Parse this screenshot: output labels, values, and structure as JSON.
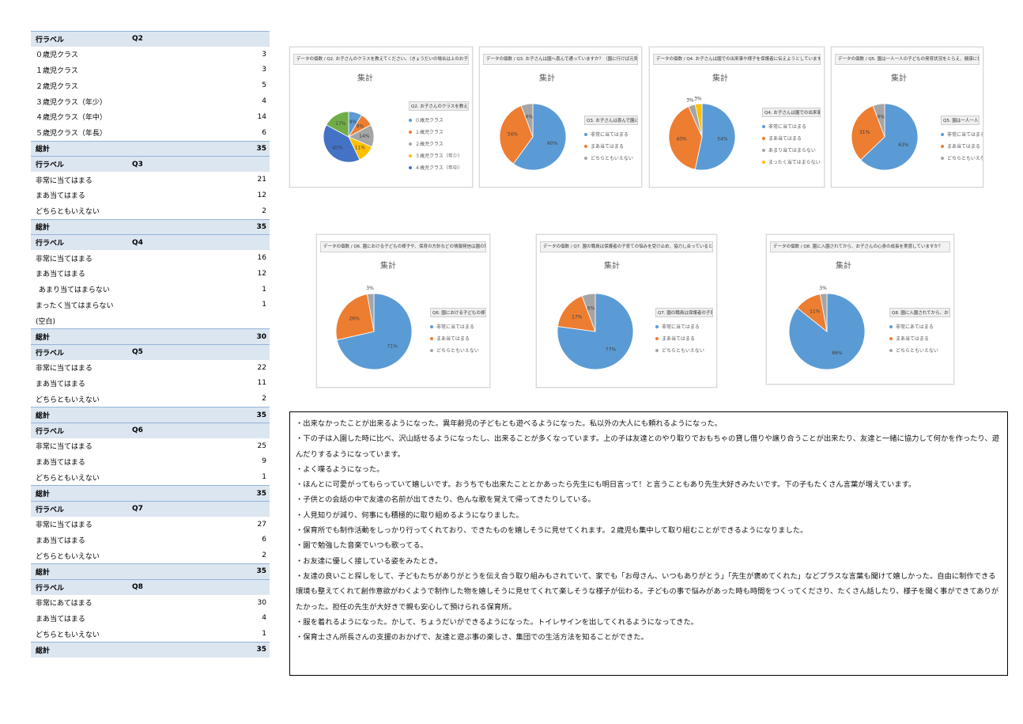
{
  "pivot": {
    "sections": [
      {
        "header": {
          "label": "行ラベル",
          "q": "Q2"
        },
        "rows": [
          {
            "label": "０歳児クラス",
            "value": "3"
          },
          {
            "label": "１歳児クラス",
            "value": "3"
          },
          {
            "label": "２歳児クラス",
            "value": "5"
          },
          {
            "label": "３歳児クラス（年少）",
            "value": "4"
          },
          {
            "label": "４歳児クラス（年中）",
            "value": "14"
          },
          {
            "label": "５歳児クラス（年長）",
            "value": "6"
          }
        ],
        "total": {
          "label": "総計",
          "value": "35"
        }
      },
      {
        "header": {
          "label": "行ラベル",
          "q": "Q3"
        },
        "rows": [
          {
            "label": "非常に当てはまる",
            "value": "21"
          },
          {
            "label": "まあ当てはまる",
            "value": "12"
          },
          {
            "label": "どちらともいえない",
            "value": "2"
          }
        ],
        "total": {
          "label": "総計",
          "value": "35"
        }
      },
      {
        "header": {
          "label": "行ラベル",
          "q": "Q4"
        },
        "rows": [
          {
            "label": "非常に当てはまる",
            "value": "16"
          },
          {
            "label": "まあ当てはまる",
            "value": "12"
          },
          {
            "label": "あまり当てはまらない",
            "value": "1"
          },
          {
            "label": "まったく当てはまらない",
            "value": "1"
          },
          {
            "label": "(空白)",
            "value": ""
          }
        ],
        "total": {
          "label": "総計",
          "value": "30"
        }
      },
      {
        "header": {
          "label": "行ラベル",
          "q": "Q5"
        },
        "rows": [
          {
            "label": "非常に当てはまる",
            "value": "22"
          },
          {
            "label": "まあ当てはまる",
            "value": "11"
          },
          {
            "label": "どちらともいえない",
            "value": "2"
          }
        ],
        "total": {
          "label": "総計",
          "value": "35"
        }
      },
      {
        "header": {
          "label": "行ラベル",
          "q": "Q6"
        },
        "rows": [
          {
            "label": "非常に当てはまる",
            "value": "25"
          },
          {
            "label": "まあ当てはまる",
            "value": "9"
          },
          {
            "label": "どちらともいえない",
            "value": "1"
          }
        ],
        "total": {
          "label": "総計",
          "value": "35"
        }
      },
      {
        "header": {
          "label": "行ラベル",
          "q": "Q7"
        },
        "rows": [
          {
            "label": "非常に当てはまる",
            "value": "27"
          },
          {
            "label": "まあ当てはまる",
            "value": "6"
          },
          {
            "label": "どちらともいえない",
            "value": "2"
          }
        ],
        "total": {
          "label": "総計",
          "value": "35"
        }
      },
      {
        "header": {
          "label": "行ラベル",
          "q": "Q8"
        },
        "rows": [
          {
            "label": "非常にあてはまる",
            "value": "30"
          },
          {
            "label": "まあ当てはまる",
            "value": "4"
          },
          {
            "label": "どちらともいえない",
            "value": "1"
          }
        ],
        "total": {
          "label": "総計",
          "value": "35"
        }
      }
    ]
  },
  "colors": {
    "blue": "#5b9bd5",
    "orange": "#ed7d31",
    "gray": "#a5a5a5",
    "yellow": "#ffc000",
    "navy": "#4472c4",
    "green": "#70ad47",
    "header_fill": "#dce6f1"
  },
  "chart_data": [
    {
      "type": "pie",
      "title": "データの個数 / Q2. お子さんのクラスを教えてください。（きょうだいの場合は上のお子さんの年齢をお答えくだ...",
      "subtitle": "集計",
      "legend_title": "Q2. お子さんのクラスを教えてくい... ▾",
      "labels": [
        "０歳児クラス",
        "１歳児クラス",
        "２歳児クラス",
        "３歳児クラス（年少）",
        "４歳児クラス（年中）"
      ],
      "slices": [
        {
          "label": "０歳児クラス",
          "value": 3,
          "pct": "9%",
          "color": "#5b9bd5"
        },
        {
          "label": "１歳児クラス",
          "value": 3,
          "pct": "9%",
          "color": "#ed7d31"
        },
        {
          "label": "２歳児クラス",
          "value": 5,
          "pct": "14%",
          "color": "#a5a5a5"
        },
        {
          "label": "３歳児クラス（年少）",
          "value": 4,
          "pct": "11%",
          "color": "#ffc000"
        },
        {
          "label": "４歳児クラス（年中）",
          "value": 14,
          "pct": "40%",
          "color": "#4472c4"
        },
        {
          "label": "５歳児クラス（年長）",
          "value": 6,
          "pct": "17%",
          "color": "#70ad47"
        }
      ]
    },
    {
      "type": "pie",
      "title": "データの個数 / Q3. お子さんは園へ喜んで通っていますか？（園に行けば元気に過ごしていますか？）[回答...",
      "subtitle": "集計",
      "legend_title": "Q3. お子さんは喜んで園に... ▾",
      "labels": [
        "非常に当てはまる",
        "まあ当てはまる",
        "どちらともいえない"
      ],
      "slices": [
        {
          "label": "非常に当てはまる",
          "value": 21,
          "pct": "60%",
          "color": "#5b9bd5"
        },
        {
          "label": "まあ当てはまる",
          "value": 12,
          "pct": "34%",
          "color": "#ed7d31"
        },
        {
          "label": "どちらともいえない",
          "value": 2,
          "pct": "6%",
          "color": "#a5a5a5"
        }
      ]
    },
    {
      "type": "pie",
      "title": "データの個数 / Q4. お子さんは園での出来事や様子を保護者に伝えようとしていますか？（言葉でコミュニケーションができる年...",
      "subtitle": "集計",
      "legend_title": "Q4. お子さんは園での出来事や様... ▾",
      "labels": [
        "非常に当てはまる",
        "まあ当てはまる",
        "あまり当てはまらない",
        "まったく当てはまらない"
      ],
      "slices": [
        {
          "label": "非常に当てはまる",
          "value": 16,
          "pct": "54%",
          "color": "#5b9bd5"
        },
        {
          "label": "まあ当てはまる",
          "value": 12,
          "pct": "40%",
          "color": "#ed7d31"
        },
        {
          "label": "あまり当てはまらない",
          "value": 1,
          "pct": "3%",
          "color": "#a5a5a5"
        },
        {
          "label": "まったく当てはまらない",
          "value": 1,
          "pct": "3%",
          "color": "#ffc000"
        }
      ]
    },
    {
      "type": "pie",
      "title": "データの個数 / Q5. 園は一人一人の子どもの発育状況をとらえ、健康に保護者が子育てに支援を行っていますか？[回答必須]",
      "subtitle": "集計",
      "legend_title": "Q5. 園は一人一人の子どもの発育... ▾",
      "labels": [
        "非常に当てはまる",
        "まあ当てはまる",
        "どちらともいえない"
      ],
      "slices": [
        {
          "label": "非常に当てはまる",
          "value": 22,
          "pct": "63%",
          "color": "#5b9bd5"
        },
        {
          "label": "まあ当てはまる",
          "value": 11,
          "pct": "31%",
          "color": "#ed7d31"
        },
        {
          "label": "どちらともいえない",
          "value": 2,
          "pct": "6%",
          "color": "#a5a5a5"
        }
      ]
    },
    {
      "type": "pie",
      "title": "データの個数 / Q6. 園における子どもの様子や、保育の方針などの情報発信は園の取り組みが伝わるものですか？[回答必須]",
      "subtitle": "集計",
      "legend_title": "Q6. 園における子どもの様子や、保育... ▾",
      "labels": [
        "非常に当てはまる",
        "まあ当てはまる",
        "どちらともいえない"
      ],
      "slices": [
        {
          "label": "非常に当てはまる",
          "value": 25,
          "pct": "71%",
          "color": "#5b9bd5"
        },
        {
          "label": "まあ当てはまる",
          "value": 9,
          "pct": "26%",
          "color": "#ed7d31"
        },
        {
          "label": "どちらともいえない",
          "value": 1,
          "pct": "3%",
          "color": "#a5a5a5"
        }
      ]
    },
    {
      "type": "pie",
      "title": "データの個数 / Q7. 園の職員は保護者の子育ての悩みを受け止め、協力し合っていると感じられますか？[回答必須]",
      "subtitle": "集計",
      "legend_title": "Q7. 園の職員は保護者の子育て... ▾",
      "labels": [
        "非常に当てはまる",
        "まあ当てはまる",
        "どちらともいえない"
      ],
      "slices": [
        {
          "label": "非常に当てはまる",
          "value": 27,
          "pct": "77%",
          "color": "#5b9bd5"
        },
        {
          "label": "まあ当てはまる",
          "value": 6,
          "pct": "17%",
          "color": "#ed7d31"
        },
        {
          "label": "どちらともいえない",
          "value": 2,
          "pct": "6%",
          "color": "#a5a5a5"
        }
      ]
    },
    {
      "type": "pie",
      "title": "データの個数 / Q8. 園に入園されてから、お子さんの心身の成長を実感していますか？",
      "subtitle": "集計",
      "legend_title": "Q8. 園に入園されてから、お子さん... ▾",
      "labels": [
        "非常にあてはまる",
        "まあ当てはまる",
        "どちらともいえない"
      ],
      "slices": [
        {
          "label": "非常にあてはまる",
          "value": 30,
          "pct": "86%",
          "color": "#5b9bd5"
        },
        {
          "label": "まあ当てはまる",
          "value": 4,
          "pct": "11%",
          "color": "#ed7d31"
        },
        {
          "label": "どちらともいえない",
          "value": 1,
          "pct": "3%",
          "color": "#a5a5a5"
        }
      ]
    }
  ],
  "comments": [
    "・出来なかったことが出来るようになった。異年齢児の子どもとも遊べるようになった。私以外の大人にも頼れるようになった。",
    "・下の子は入園した時に比べ、沢山話せるようになったし、出来ることが多くなっています。上の子は友達とのやり取りでおもちゃの貸し借りや譲り合うことが出来たり、友達と一緒に協力して何かを作ったり、遊んだりするようになっています。",
    "・よく喋るようになった。",
    "・ほんとに可愛がってもらっていて嬉しいです。おうちでも出来たこととかあったら先生にも明日言って！と言うこともあり先生大好きみたいです。下の子もたくさん言葉が増えています。",
    "・子供との会話の中で友達の名前が出てきたり、色んな歌を覚えて帰ってきたりしている。",
    "・人見知りが減り、何事にも積極的に取り組めるようになりました。",
    "・保育所でも制作活動をしっかり行ってくれており、できたものを嬉しそうに見せてくれます。２歳児も集中して取り組むことができるようになりました。",
    "・園で勉強した音楽でいつも歌ってる。",
    "・お友達に優しく接している姿をみたとき。",
    "・友達の良いこと探しをして、子どもたちがありがとうを伝え合う取り組みもされていて、家でも「お母さん、いつもありがとう」「先生が褒めてくれた」などプラスな言葉も聞けて嬉しかった。自由に制作できる環境も整えてくれて創作意欲がわくようで制作した物を嬉しそうに見せてくれて楽しそうな様子が伝わる。子どもの事で悩みがあった時も時間をつくってくださり、たくさん話したり、様子を聞く事ができてありがたかった。担任の先生が大好きで親も安心して預けられる保育所。",
    "・服を着れるようになった。かして、ちょうだいができるようになった。トイレサインを出してくれるようになってきた。",
    "・保育士さん所長さんの支援のおかげで、友達と遊ぶ事の楽しさ、集団での生活方法を知ることができた。"
  ]
}
